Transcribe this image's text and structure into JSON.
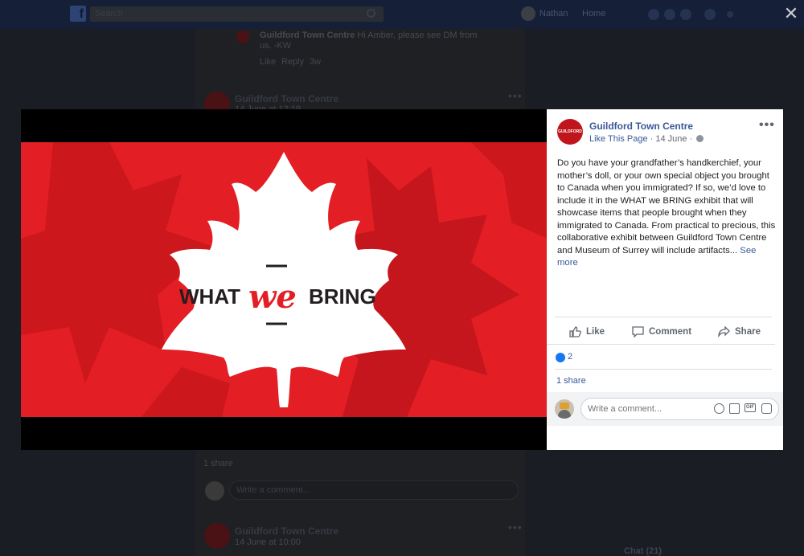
{
  "background": {
    "search_placeholder": "Search",
    "user_name": "Nathan",
    "home_label": "Home",
    "comments": [
      {
        "author": "Guildford Town Centre",
        "text": "Hi Amber, please see DM from",
        "text2": "us. -KW",
        "actions": [
          "Like",
          "Reply",
          "3w"
        ]
      }
    ],
    "posts": [
      {
        "name": "Guildford Town Centre",
        "meta": "14 June at 12:19"
      },
      {
        "name": "Guildford Town Centre",
        "meta": "14 June at 10:00"
      }
    ],
    "share_count_text": "1 share",
    "comment_placeholder": "Write a comment...",
    "chat_label": "Chat (21)"
  },
  "image": {
    "banner_word_1": "WHAT",
    "banner_word_2": "we",
    "banner_word_3": "BRING",
    "colors": {
      "bg_red": "#e31e24",
      "dark_red": "#c4161c",
      "leaf": "#ffffff",
      "text_dark": "#231f20"
    }
  },
  "panel": {
    "page_avatar_text": "GUILDFORD",
    "page_name": "Guildford Town Centre",
    "like_page": "Like This Page",
    "date": "14 June",
    "body": "Do you have your grandfather’s handkerchief, your mother’s doll, or your own special object you brought to Canada when you immigrated? If so, we’d love to include it in the WHAT we BRING exhibit that will showcase items that people brought when they immigrated to Canada. From practical to precious, this collaborative exhibit between Guildford Town Centre and Museum of Surrey will include artifacts...",
    "see_more": "See more",
    "actions": {
      "like": "Like",
      "comment": "Comment",
      "share": "Share"
    },
    "reaction_count": "2",
    "shares": "1 share",
    "comment_placeholder": "Write a comment...",
    "gif_label": "GIF"
  }
}
